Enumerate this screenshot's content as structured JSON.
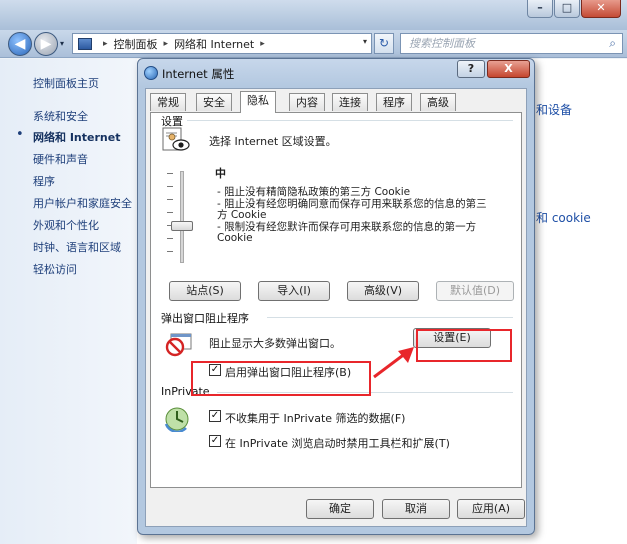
{
  "explorer": {
    "window_controls": {
      "minimize": "–",
      "maximize": "□",
      "close": "✕"
    },
    "nav": {
      "back_icon": "◀",
      "forward_icon": "▶",
      "dropdown_icon": "▾"
    },
    "address": {
      "segments": [
        "控制面板",
        "网络和 Internet"
      ],
      "separator": "▸",
      "dropdown_icon": "▾"
    },
    "refresh_icon": "↻",
    "search": {
      "placeholder": "搜索控制面板",
      "icon": "⌕"
    },
    "sidebar": {
      "home": "控制面板主页",
      "items": [
        "系统和安全",
        "网络和 Internet",
        "硬件和声音",
        "程序",
        "用户帐户和家庭安全",
        "外观和个性化",
        "时钟、语言和区域",
        "轻松访问"
      ],
      "current_bullet": "•"
    },
    "right_links": [
      "和设备",
      "和 cookie"
    ]
  },
  "dialog": {
    "title": "Internet 属性",
    "help": "?",
    "close": "X",
    "tabs": [
      "常规",
      "安全",
      "隐私",
      "内容",
      "连接",
      "程序",
      "高级"
    ],
    "active_tab": "隐私",
    "settings": {
      "group_label": "设置",
      "description": "选择 Internet 区域设置。",
      "level": "中",
      "bullets": [
        "- 阻止没有精简隐私政策的第三方 Cookie",
        "- 阻止没有经您明确同意而保存可用来联系您的信息的第三方 Cookie",
        "- 限制没有经您默许而保存可用来联系您的信息的第一方 Cookie"
      ],
      "buttons": {
        "sites": "站点(S)",
        "import": "导入(I)",
        "advanced": "高级(V)",
        "default": "默认值(D)"
      }
    },
    "popup": {
      "group_label": "弹出窗口阻止程序",
      "description": "阻止显示大多数弹出窗口。",
      "settings_button": "设置(E)",
      "checkbox_label": "启用弹出窗口阻止程序(B)",
      "checkbox_checked": true
    },
    "inprivate": {
      "group_label": "InPrivate",
      "checkbox1_label": "不收集用于 InPrivate 筛选的数据(F)",
      "checkbox1_checked": true,
      "checkbox2_label": "在 InPrivate 浏览启动时禁用工具栏和扩展(T)",
      "checkbox2_checked": true
    },
    "footer": {
      "ok": "确定",
      "cancel": "取消",
      "apply": "应用(A)"
    },
    "check_mark": "✓"
  },
  "highlight_color": "#e8262b"
}
